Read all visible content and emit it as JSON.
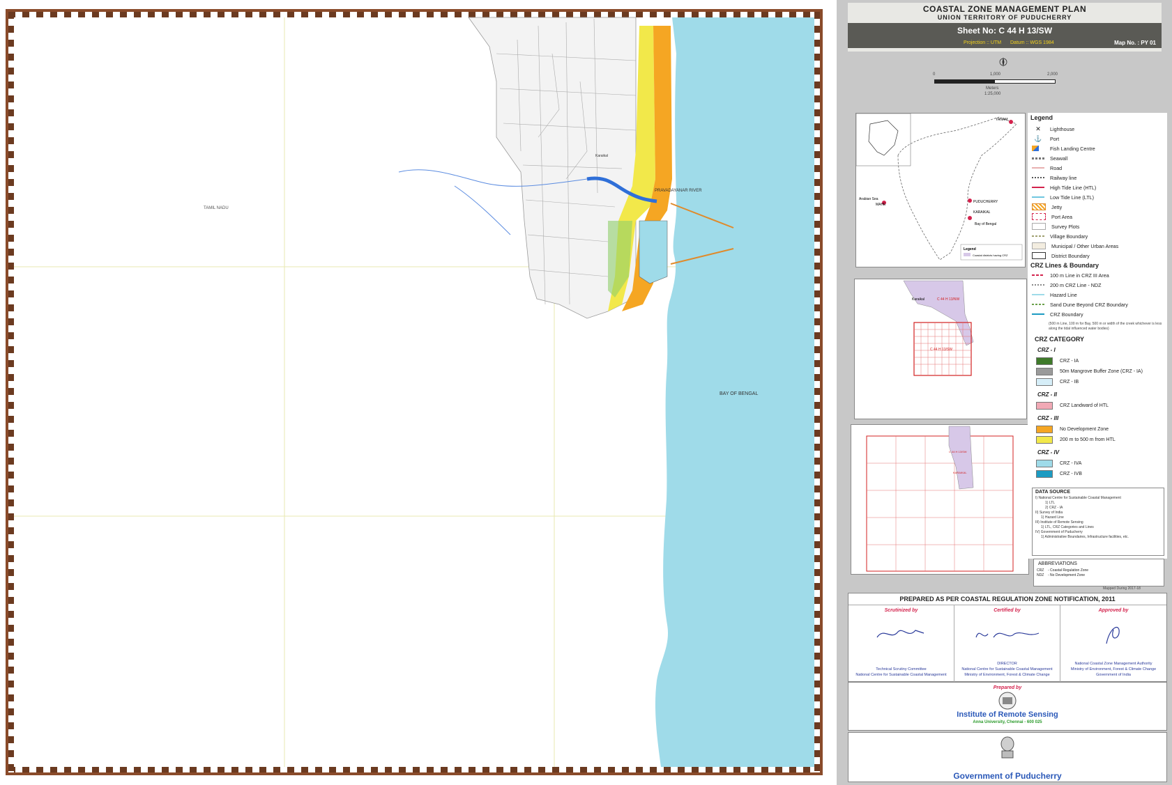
{
  "map": {
    "labels": {
      "tamil_nadu": "TAMIL NADU",
      "bay_of_bengal": "BAY OF BENGAL",
      "river": "PRAVADAYANAR RIVER",
      "karaikal": "Karaikal"
    },
    "colors": {
      "sea": "#9fdbe9",
      "no_dev_zone": "#f5a623",
      "zone_200_500": "#f2e84a",
      "crz_iii_green": "#8fcf6a",
      "river": "#2f6fd8",
      "border": "#8a4b2a"
    }
  },
  "header": {
    "title": "COASTAL ZONE MANAGEMENT PLAN",
    "subtitle": "UNION TERRITORY OF PUDUCHERRY",
    "sheet": "Sheet No: C 44 H 13/SW",
    "projection": "Projection :: UTM",
    "datum": "Datum :: WGS 1984",
    "map_no": "Map No. : PY 01"
  },
  "scale": {
    "north_icon": "compass-rose-icon",
    "ticks": [
      "0",
      "1,000",
      "2,000"
    ],
    "unit": "Meters",
    "ratio": "1:25,000"
  },
  "locator": {
    "labels": {
      "yanam": "YANAM",
      "puducherry": "PUDUCHERRY",
      "karaikal": "KARAIKAL",
      "arabian_sea": "Arabian Sea",
      "bay_of_bengal": "Bay of Bengal",
      "mahe": "MAHE",
      "legend_title": "Legend",
      "legend_item": "Coastal districts having CRZ"
    }
  },
  "sheet_index_1": {
    "karaikal": "Karaikal",
    "sheet_a": "C 44 H 13/NW",
    "sheet_b": "C 44 H 13/SW"
  },
  "sheet_index_2": {
    "label_a": "C 44 H 13/SW",
    "label_b": "KARAIKAL"
  },
  "legend": {
    "title": "Legend",
    "items": [
      {
        "label": "Lighthouse",
        "icon": "lighthouse-icon"
      },
      {
        "label": "Port",
        "icon": "port-icon"
      },
      {
        "label": "Fish Landing Centre",
        "icon": "fish-landing-icon"
      },
      {
        "label": "Seawall",
        "icon": "seawall-line"
      },
      {
        "label": "Road",
        "icon": "road-line"
      },
      {
        "label": "Railway line",
        "icon": "railway-line"
      },
      {
        "label": "High Tide Line (HTL)",
        "icon": "htl-line"
      },
      {
        "label": "Low Tide Line (LTL)",
        "icon": "ltl-line"
      },
      {
        "label": "Jetty",
        "icon": "jetty-swatch"
      },
      {
        "label": "Port Area",
        "icon": "port-area-swatch"
      },
      {
        "label": "Survey Plots",
        "icon": "survey-plots-swatch"
      },
      {
        "label": "Village Boundary",
        "icon": "village-boundary-line"
      },
      {
        "label": "Municipal / Other Urban Areas",
        "icon": "urban-swatch"
      },
      {
        "label": "District Boundary",
        "icon": "district-boundary-swatch"
      }
    ],
    "crz_lines_title": "CRZ Lines & Boundary",
    "crz_lines": [
      {
        "label": "100 m Line in CRZ III Area"
      },
      {
        "label": "200 m CRZ Line - NDZ"
      },
      {
        "label": "Hazard Line"
      },
      {
        "label": "Sand Dune Beyond CRZ Boundary"
      },
      {
        "label": "CRZ Boundary"
      }
    ],
    "crz_note": "(500 m Line, 100 m for Bay, 500 m or width of the creek whichever is less along the tidal influenced water bodies)",
    "category_title": "CRZ CATEGORY",
    "crz_i": "CRZ - I",
    "crz_i_items": [
      {
        "label": "CRZ - IA",
        "color": "#3f7a2a"
      },
      {
        "label": "50m Mangrove Buffer Zone (CRZ - IA)",
        "color": "#9a9a9a"
      },
      {
        "label": "CRZ - IB",
        "color": "#d6eef8"
      }
    ],
    "crz_ii": "CRZ - II",
    "crz_ii_items": [
      {
        "label": "CRZ Landward of HTL",
        "color": "#f1a9b5"
      }
    ],
    "crz_iii": "CRZ - III",
    "crz_iii_items": [
      {
        "label": "No Development Zone",
        "color": "#f5a623"
      },
      {
        "label": "200 m to 500 m from HTL",
        "color": "#f2e84a"
      }
    ],
    "crz_iv": "CRZ - IV",
    "crz_iv_items": [
      {
        "label": "CRZ - IVA",
        "color": "#9fdbe9"
      },
      {
        "label": "CRZ - IVB",
        "color": "#1c9bc2"
      }
    ]
  },
  "data_source": {
    "title": "DATA SOURCE",
    "lines": [
      "I) National Centre for Sustainable Coastal Management",
      "1) LTL",
      "2) CRZ - IA",
      "II) Survey of India",
      "1) Hazard Line",
      "III) Institute of Remote Sensing",
      "1) LTL, CRZ Categories and Lines",
      "IV) Government of Puducherry",
      "1) Administrative Boundaries, Infrastructure facilities, etc."
    ]
  },
  "abbreviations": {
    "title": "ABBREVIATIONS",
    "rows": [
      {
        "abbr": "CRZ",
        "meaning": "- Coastal Regulation Zone"
      },
      {
        "abbr": "NDZ",
        "meaning": "- No Development Zone"
      }
    ]
  },
  "mapped": "Mapped During 2017-18",
  "prepared_as_per": "PREPARED AS PER COASTAL REGULATION ZONE NOTIFICATION, 2011",
  "signatures": [
    {
      "head": "Scrutinized by",
      "line1": "Technical Scrutiny Committee",
      "line2": "National Centre for Sustainable Coastal Management"
    },
    {
      "head": "Certified by",
      "line1": "DIRECTOR",
      "line2": "National Centre for Sustainable Coastal Management",
      "line3": "Ministry of Environment, Forest & Climate Change"
    },
    {
      "head": "Approved by",
      "line1": "National Coastal Zone Management Authority",
      "line2": "Ministry of Environment, Forest & Climate Change",
      "line3": "Government of India"
    }
  ],
  "prepared_by": {
    "head": "Prepared by",
    "org": "Institute of Remote Sensing",
    "sub": "Anna University, Chennai - 600 025"
  },
  "government": "Government of Puducherry"
}
